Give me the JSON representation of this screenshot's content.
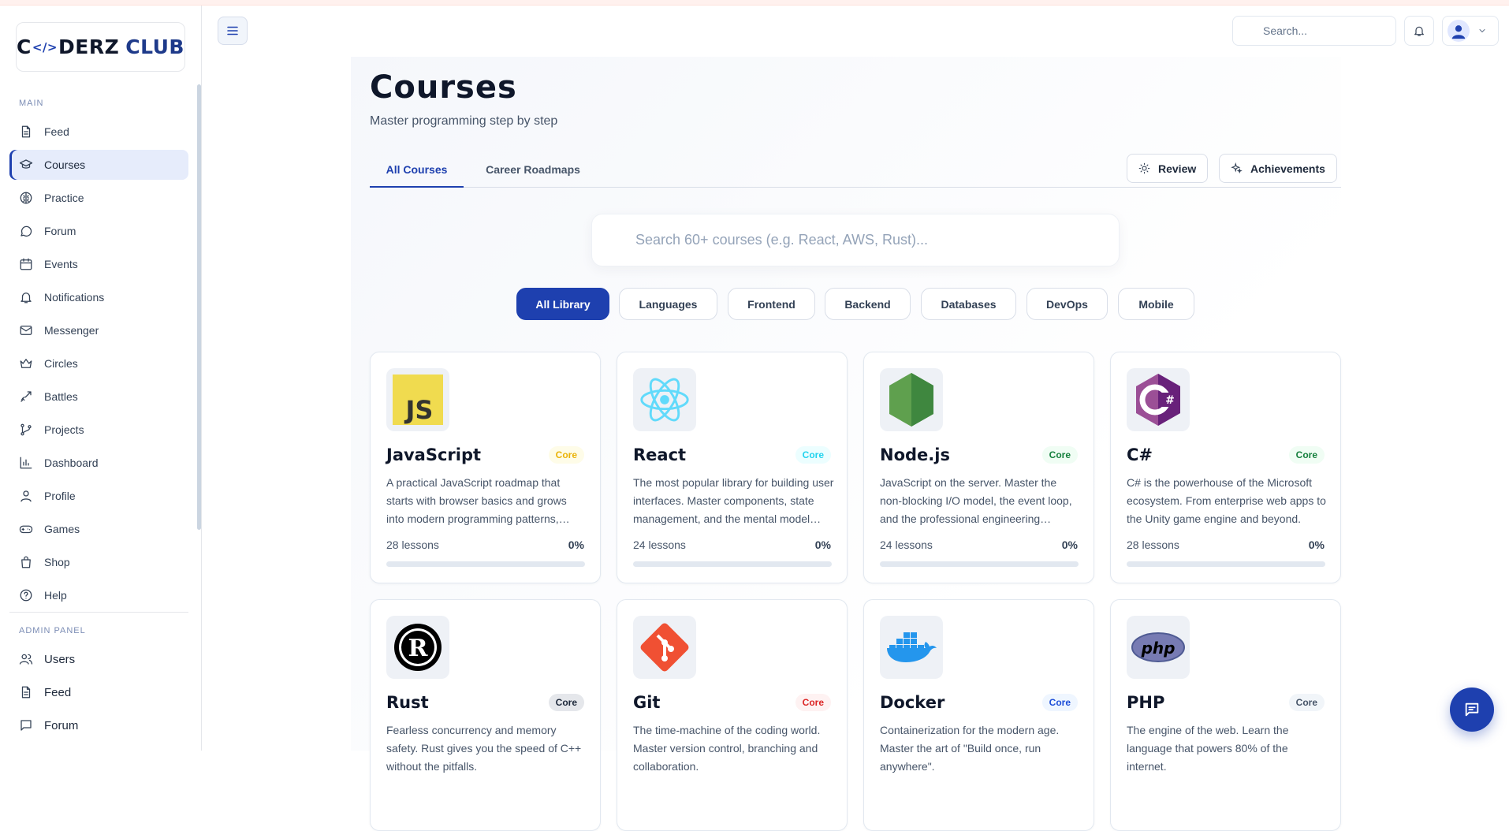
{
  "brand": {
    "part1": "C",
    "brace": "</>",
    "part2": "DERZ",
    "part3": "CLUB"
  },
  "sidebar": {
    "main_label": "MAIN",
    "items": [
      {
        "label": "Feed",
        "icon": "file-icon"
      },
      {
        "label": "Courses",
        "icon": "graduation-cap-icon",
        "active": true
      },
      {
        "label": "Practice",
        "icon": "brain-icon"
      },
      {
        "label": "Forum",
        "icon": "chat-bubble-icon"
      },
      {
        "label": "Events",
        "icon": "calendar-icon"
      },
      {
        "label": "Notifications",
        "icon": "bell-icon"
      },
      {
        "label": "Messenger",
        "icon": "mail-icon"
      },
      {
        "label": "Circles",
        "icon": "crown-icon"
      },
      {
        "label": "Battles",
        "icon": "sword-icon"
      },
      {
        "label": "Projects",
        "icon": "git-branch-icon"
      },
      {
        "label": "Dashboard",
        "icon": "bar-chart-icon"
      },
      {
        "label": "Profile",
        "icon": "user-icon"
      },
      {
        "label": "Games",
        "icon": "gamepad-icon"
      },
      {
        "label": "Shop",
        "icon": "shopping-bag-icon"
      },
      {
        "label": "Help",
        "icon": "help-circle-icon"
      }
    ],
    "admin_label": "ADMIN PANEL",
    "admin_items": [
      {
        "label": "Users",
        "icon": "users-icon"
      },
      {
        "label": "Feed",
        "icon": "file-icon"
      },
      {
        "label": "Forum",
        "icon": "chat-square-icon"
      }
    ]
  },
  "topbar": {
    "search_placeholder": "Search..."
  },
  "page": {
    "title": "Courses",
    "subtitle": "Master programming step by step",
    "tabs": [
      "All Courses",
      "Career Roadmaps"
    ],
    "review_label": "Review",
    "achievements_label": "Achievements",
    "course_search_placeholder": "Search 60+ courses (e.g. React, AWS, Rust)...",
    "filters": [
      "All Library",
      "Languages",
      "Frontend",
      "Backend",
      "Databases",
      "DevOps",
      "Mobile"
    ]
  },
  "courses": [
    {
      "name": "JavaScript",
      "badge": "Core",
      "badge_color": "#eab308",
      "badge_bg": "#fefce8",
      "desc": "A practical JavaScript roadmap that starts with browser basics and grows into modern programming patterns, async code and tooling.",
      "lessons": "28 lessons",
      "progress": "0%",
      "progress_value": 0
    },
    {
      "name": "React",
      "badge": "Core",
      "badge_color": "#22d3ee",
      "badge_bg": "#ecfeff",
      "desc": "The most popular library for building user interfaces. Master components, state management, and the mental model behind modern UIs.",
      "lessons": "24 lessons",
      "progress": "0%",
      "progress_value": 0
    },
    {
      "name": "Node.js",
      "badge": "Core",
      "badge_color": "#15803d",
      "badge_bg": "#f0fdf4",
      "desc": "JavaScript on the server. Master the non-blocking I/O model, the event loop, and the professional engineering patterns.",
      "lessons": "24 lessons",
      "progress": "0%",
      "progress_value": 0
    },
    {
      "name": "C#",
      "badge": "Core",
      "badge_color": "#15803d",
      "badge_bg": "#f0fdf4",
      "desc": "C# is the powerhouse of the Microsoft ecosystem. From enterprise web apps to the Unity game engine and beyond.",
      "lessons": "28 lessons",
      "progress": "0%",
      "progress_value": 0
    },
    {
      "name": "Rust",
      "badge": "Core",
      "badge_color": "#1e293b",
      "badge_bg": "#e5e7eb",
      "desc": "Fearless concurrency and memory safety. Rust gives you the speed of C++ without the pitfalls.",
      "lessons": "",
      "progress": "",
      "progress_value": 0
    },
    {
      "name": "Git",
      "badge": "Core",
      "badge_color": "#dc2626",
      "badge_bg": "#fef2f2",
      "desc": "The time-machine of the coding world. Master version control, branching and collaboration.",
      "lessons": "",
      "progress": "",
      "progress_value": 0
    },
    {
      "name": "Docker",
      "badge": "Core",
      "badge_color": "#1d4ed8",
      "badge_bg": "#eff6ff",
      "desc": "Containerization for the modern age. Master the art of \"Build once, run anywhere\".",
      "lessons": "",
      "progress": "",
      "progress_value": 0
    },
    {
      "name": "PHP",
      "badge": "Core",
      "badge_color": "#475569",
      "badge_bg": "#f1f5f9",
      "desc": "The engine of the web. Learn the language that powers 80% of the internet.",
      "lessons": "",
      "progress": "",
      "progress_value": 0
    }
  ],
  "colors": {
    "accent": "#1e40af",
    "active_bg": "#e6ecfb"
  }
}
